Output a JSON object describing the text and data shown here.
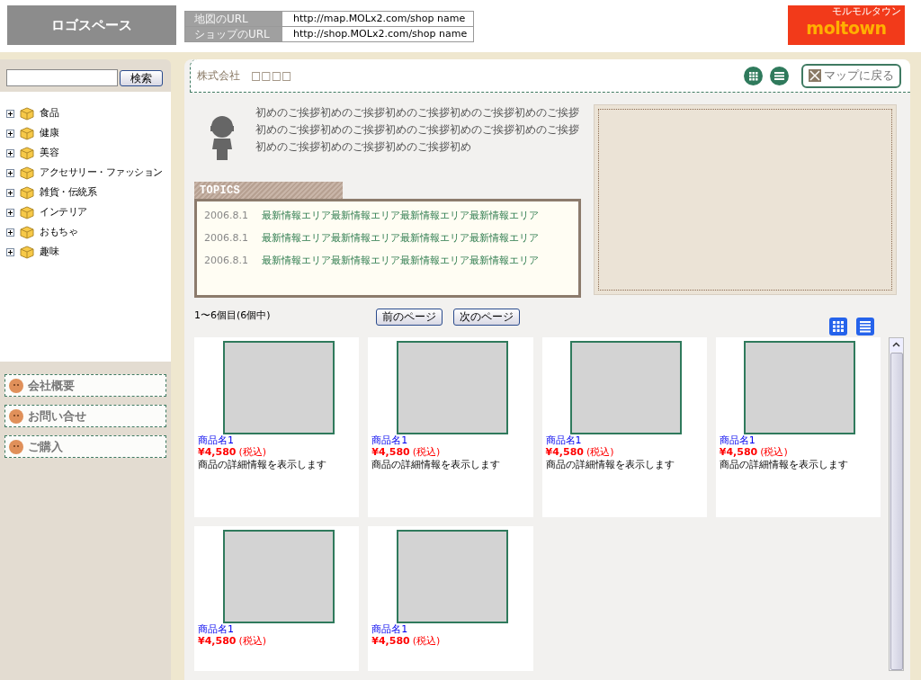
{
  "logo_space": "ロゴスペース",
  "urls": [
    {
      "label": "地図のURL",
      "value": "http://map.MOLx2.com/shop name"
    },
    {
      "label": "ショップのURL",
      "value": "http://shop.MOLx2.com/shop name"
    }
  ],
  "brand": {
    "name": "moltown",
    "tagline": "モルモルタウン"
  },
  "search": {
    "button": "検索"
  },
  "categories": [
    {
      "label": "食品",
      "expanded": false
    },
    {
      "label": "健康",
      "expanded": false
    },
    {
      "label": "美容",
      "expanded": false
    },
    {
      "label": "アクセサリー・ファッション",
      "expanded": false
    },
    {
      "label": "雑貨・伝統系",
      "expanded": false
    },
    {
      "label": "インテリア",
      "expanded": false
    },
    {
      "label": "おもちゃ",
      "expanded": false
    },
    {
      "label": "趣味",
      "expanded": false
    }
  ],
  "side_links": [
    "会社概要",
    "お問い合せ",
    "ご購入"
  ],
  "shop_name": "株式会社　□□□□",
  "back_button": "マップに戻る",
  "greeting": "初めのご挨拶初めのご挨拶初めのご挨拶初めのご挨拶初めのご挨拶初めのご挨拶初めのご挨拶初めのご挨拶初めのご挨拶初めのご挨拶初めのご挨拶初めのご挨拶初めのご挨拶初め",
  "topics": {
    "title": "TOPICS",
    "items": [
      {
        "date": "2006.8.1",
        "text": "最新情報エリア最新情報エリア最新情報エリア最新情報エリア"
      },
      {
        "date": "2006.8.1",
        "text": "最新情報エリア最新情報エリア最新情報エリア最新情報エリア"
      },
      {
        "date": "2006.8.1",
        "text": "最新情報エリア最新情報エリア最新情報エリア最新情報エリア"
      }
    ]
  },
  "pagination": {
    "range": "1〜6個目(6個中)",
    "prev": "前のページ",
    "next": "次のページ"
  },
  "products": [
    {
      "name": "商品名1",
      "price": "¥4,580",
      "tax": "(税込)",
      "description": "商品の詳細情報を表示します"
    },
    {
      "name": "商品名1",
      "price": "¥4,580",
      "tax": "(税込)",
      "description": "商品の詳細情報を表示します"
    },
    {
      "name": "商品名1",
      "price": "¥4,580",
      "tax": "(税込)",
      "description": "商品の詳細情報を表示します"
    },
    {
      "name": "商品名1",
      "price": "¥4,580",
      "tax": "(税込)",
      "description": "商品の詳細情報を表示します"
    },
    {
      "name": "商品名1",
      "price": "¥4,580",
      "tax": "(税込)"
    },
    {
      "name": "商品名1",
      "price": "¥4,580",
      "tax": "(税込)"
    }
  ]
}
